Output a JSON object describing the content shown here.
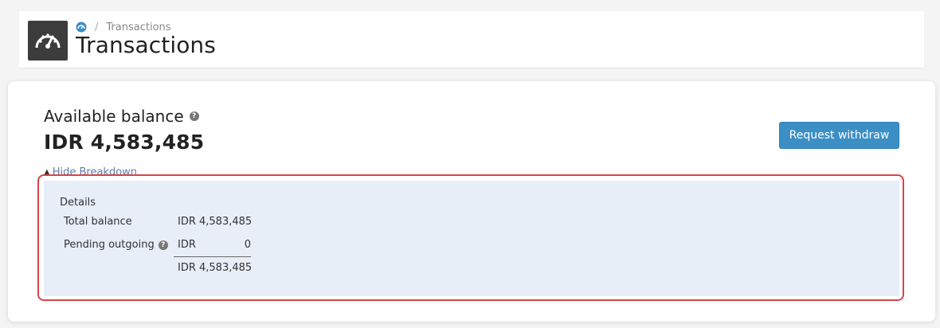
{
  "header": {
    "breadcrumb": {
      "current": "Transactions",
      "separator": "/"
    },
    "title": "Transactions"
  },
  "balance": {
    "label": "Available balance",
    "amount": "IDR 4,583,485",
    "info_icon": "?"
  },
  "actions": {
    "withdraw_label": "Request withdraw"
  },
  "breakdown": {
    "toggle_label": "Hide Breakdown",
    "heading": "Details",
    "rows": [
      {
        "label": "Total balance",
        "currency": "IDR",
        "value": "4,583,485"
      },
      {
        "label": "Pending outgoing",
        "currency": "IDR",
        "value": "0",
        "info_icon": "?"
      },
      {
        "label": "",
        "currency": "IDR",
        "value": "4,583,485"
      }
    ]
  },
  "colors": {
    "accent": "#3b8fc4",
    "highlight": "#d9434b",
    "panel": "#e8eef8",
    "link": "#5a7fa8"
  },
  "icons": {
    "logo": "speedometer-icon",
    "home": "dashboard-icon",
    "info": "question-circle-icon",
    "caret": "caret-up-icon"
  }
}
